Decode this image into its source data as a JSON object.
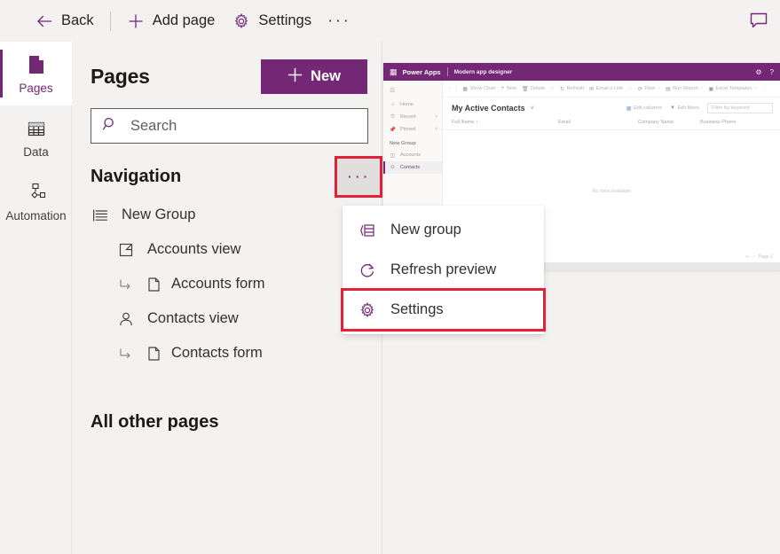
{
  "commandbar": {
    "back": "Back",
    "add_page": "Add page",
    "settings": "Settings",
    "overflow": "···",
    "comment_icon": "comment-icon"
  },
  "rail": {
    "items": [
      {
        "label": "Pages",
        "icon": "page-icon",
        "active": true
      },
      {
        "label": "Data",
        "icon": "table-icon",
        "active": false
      },
      {
        "label": "Automation",
        "icon": "flow-icon",
        "active": false
      }
    ]
  },
  "pages_panel": {
    "title": "Pages",
    "new_button": "New",
    "search_placeholder": "Search",
    "search_value": "",
    "navigation_title": "Navigation",
    "more_label": "···",
    "tree": [
      {
        "label": "New Group",
        "icon": "group-list-icon",
        "level": 0
      },
      {
        "label": "Accounts view",
        "icon": "view-icon",
        "level": 1
      },
      {
        "label": "Accounts form",
        "icon": "form-page-icon",
        "level": 2
      },
      {
        "label": "Contacts view",
        "icon": "contact-icon",
        "level": 1
      },
      {
        "label": "Contacts form",
        "icon": "form-page-icon",
        "level": 2
      }
    ],
    "all_other_pages": "All other pages"
  },
  "context_menu": {
    "items": [
      {
        "label": "New group",
        "icon": "new-group-icon",
        "highlighted": false
      },
      {
        "label": "Refresh preview",
        "icon": "refresh-icon",
        "highlighted": false
      },
      {
        "label": "Settings",
        "icon": "gear-icon",
        "highlighted": true
      }
    ]
  },
  "preview": {
    "brand": "Power Apps",
    "app_name": "Modern app designer",
    "waffle_icon": "waffle-icon",
    "settings_icon": "gear-icon",
    "help_icon": "help-icon",
    "nav": {
      "hamburger_icon": "hamburger-icon",
      "items": [
        {
          "label": "Home",
          "icon": "home-icon",
          "chevron": false
        },
        {
          "label": "Recent",
          "icon": "clock-icon",
          "chevron": true
        },
        {
          "label": "Pinned",
          "icon": "pin-icon",
          "chevron": true
        }
      ],
      "group_label": "New Group",
      "group_items": [
        {
          "label": "Accounts",
          "icon": "view-icon",
          "selected": false
        },
        {
          "label": "Contacts",
          "icon": "contact-icon",
          "selected": true
        }
      ]
    },
    "commands": [
      {
        "label": "Show Chart",
        "icon": "chart-icon"
      },
      {
        "label": "New",
        "icon": "plus-icon"
      },
      {
        "label": "Delete",
        "icon": "trash-icon"
      },
      {
        "label": "Refresh",
        "icon": "refresh-icon"
      },
      {
        "label": "Email a Link",
        "icon": "link-icon"
      },
      {
        "label": "Flow",
        "icon": "flow-icon"
      },
      {
        "label": "Run Report",
        "icon": "report-icon"
      },
      {
        "label": "Excel Templates",
        "icon": "excel-icon"
      }
    ],
    "view_name": "My Active Contacts",
    "view_tools": [
      {
        "label": "Edit columns",
        "icon": "columns-icon"
      },
      {
        "label": "Edit filters",
        "icon": "filter-icon"
      }
    ],
    "filter_placeholder": "Filter by keyword",
    "columns": [
      "Full Name ↑",
      "Email",
      "Company Name",
      "Business Phone"
    ],
    "empty_message": "No data available",
    "pager_label": "Page 1"
  },
  "colors": {
    "brand": "#742774",
    "highlight": "#e3203a",
    "panel_bg": "#f3f2f1"
  }
}
